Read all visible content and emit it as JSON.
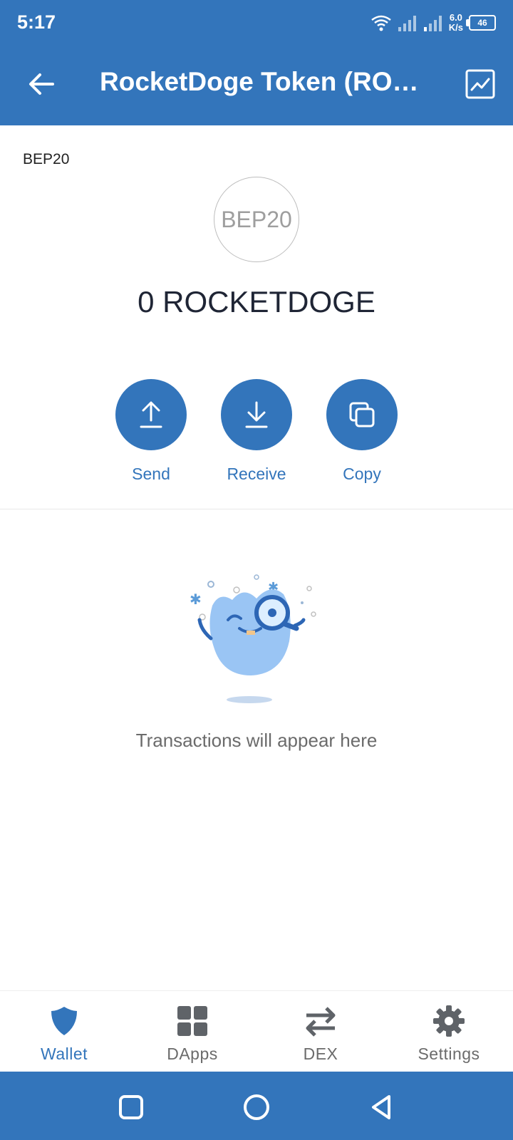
{
  "status_bar": {
    "time": "5:17",
    "net_speed_value": "6.0",
    "net_speed_unit": "K/s",
    "battery": "46"
  },
  "header": {
    "title": "RocketDoge Token (RO…"
  },
  "token": {
    "network": "BEP20",
    "logo_text": "BEP20",
    "balance": "0 ROCKETDOGE"
  },
  "actions": [
    {
      "label": "Send"
    },
    {
      "label": "Receive"
    },
    {
      "label": "Copy"
    }
  ],
  "empty_state": {
    "message": "Transactions will appear here"
  },
  "bottom_nav": [
    {
      "label": "Wallet",
      "icon": "shield-icon",
      "active": true
    },
    {
      "label": "DApps",
      "icon": "grid-icon",
      "active": false
    },
    {
      "label": "DEX",
      "icon": "swap-icon",
      "active": false
    },
    {
      "label": "Settings",
      "icon": "gear-icon",
      "active": false
    }
  ],
  "colors": {
    "primary": "#3375BB",
    "text_dark": "#1f2535",
    "text_muted": "#6b6b6b"
  }
}
